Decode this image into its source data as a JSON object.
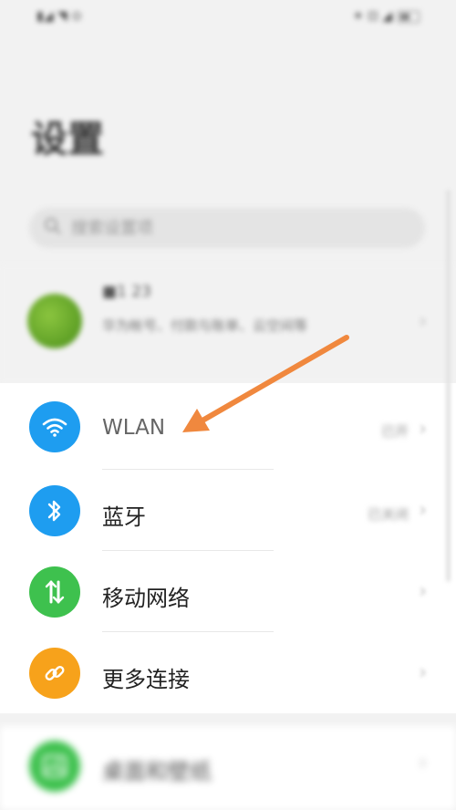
{
  "status_bar": {
    "left_text": "▮◢ ◥ ⊙",
    "right_text": "✶ ⊡ ◢"
  },
  "page": {
    "title": "设置"
  },
  "search": {
    "placeholder": "搜索设置项"
  },
  "account": {
    "name": "■1 23",
    "description": "华为帐号、付款与账单、云空间等"
  },
  "connectivity": {
    "items": [
      {
        "id": "wlan",
        "label": "WLAN",
        "value": "已开",
        "icon": "wifi-icon"
      },
      {
        "id": "bluetooth",
        "label": "蓝牙",
        "value": "已关闭",
        "icon": "bluetooth-icon"
      },
      {
        "id": "mobile",
        "label": "移动网络",
        "value": "",
        "icon": "mobile-network-icon"
      },
      {
        "id": "more",
        "label": "更多连接",
        "value": "",
        "icon": "link-icon"
      }
    ]
  },
  "display": {
    "items": [
      {
        "id": "desktop",
        "label": "桌面和壁纸",
        "icon": "wallpaper-icon"
      }
    ]
  },
  "colors": {
    "blue": "#1e9df0",
    "green": "#3ec14e",
    "orange": "#f7a21b",
    "arrow": "#f0883e"
  }
}
